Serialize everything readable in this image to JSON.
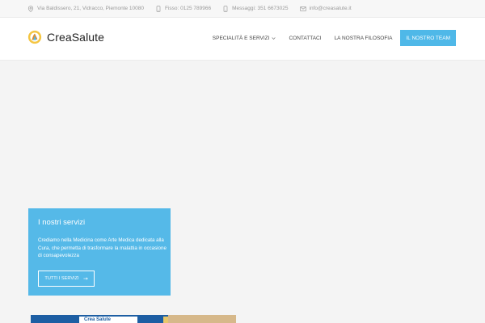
{
  "topbar": {
    "address": "Via Baldissero, 21, Vidracco, Piemonte 10080",
    "phone": "Fisso: 0125 789966",
    "messages": "Messaggi: 351 6673025",
    "email": "info@creasalute.it"
  },
  "header": {
    "logo_text": "CreaSalute",
    "nav": [
      {
        "label": "SPECIALITÀ E SERVIZI"
      },
      {
        "label": "CONTATTACI"
      },
      {
        "label": "LA NOSTRA FILOSOFIA"
      },
      {
        "label": "IL NOSTRO TEAM"
      }
    ]
  },
  "card": {
    "title": "I nostri servizi",
    "text": "Crediamo nella Medicina come Arte Medica dedicata alla Cura, che permetta di trasformare la malattia in occasione di consapevolezza",
    "button": "TUTTI I SERVIZI"
  },
  "photo": {
    "sign_text": "Crea Salute"
  },
  "colors": {
    "accent": "#4fb8e8",
    "card": "#55b9e8"
  }
}
